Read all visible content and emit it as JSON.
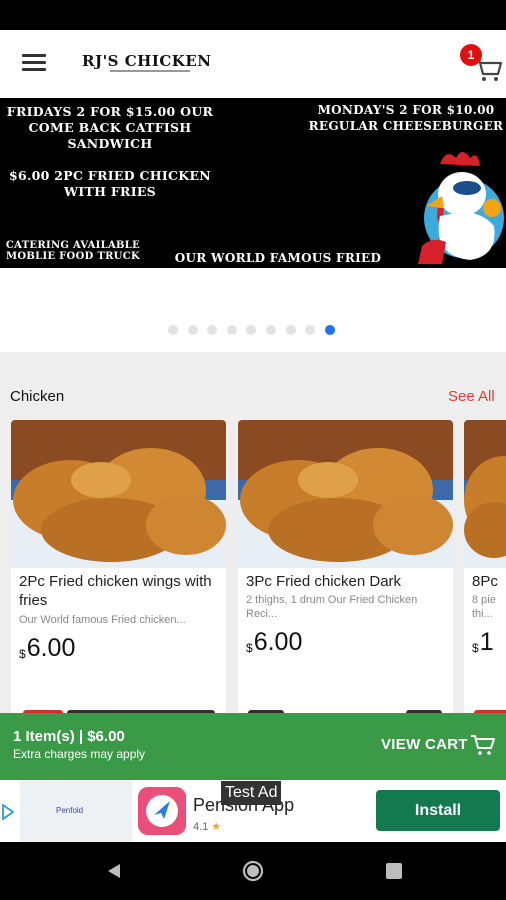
{
  "app": {
    "logo_text": "RJ'S CHICKEN",
    "cart_badge_count": "1"
  },
  "banner": {
    "line_friday": "FRIDAYS 2 FOR $15.00 OUR COME BACK CATFISH SANDWICH",
    "line_monday": "MONDAY'S 2 FOR $10.00 REGULAR CHEESEBURGER",
    "line_price": "$6.00 2PC FRIED CHICKEN WITH FRIES",
    "line_catering": "CATERING AVAILABLE MOBLIE FOOD TRUCK",
    "line_famous": "OUR WORLD FAMOUS FRIED CHICKEN",
    "slides_total": 9,
    "active_slide": 9
  },
  "section": {
    "title": "Chicken",
    "see_all": "See All"
  },
  "products": [
    {
      "title": "2Pc Fried chicken wings with fries",
      "description": "Our World famous Fried chicken...",
      "currency": "$",
      "price": "6.00"
    },
    {
      "title": "3Pc Fried chicken Dark",
      "description": "2 thighs, 1 drum Our Fried Chicken Reci...",
      "currency": "$",
      "price": "6.00"
    },
    {
      "title": "8Pc",
      "description": "8 pie thi...",
      "currency": "$",
      "price": "1"
    }
  ],
  "cart_bar": {
    "summary": "1 Item(s) | $6.00",
    "extra": "Extra charges may apply",
    "view_cart": "VIEW CART"
  },
  "ad": {
    "test_label": "Test Ad",
    "app_name": "Pension App",
    "rating": "4.1",
    "install": "Install",
    "thumb_brand": "Penfold"
  },
  "colors": {
    "accent_green": "#3a9a47",
    "see_all_red": "#e53935",
    "badge_red": "#e01010",
    "dot_active_blue": "#1e73e8",
    "install_green": "#137a4f"
  }
}
